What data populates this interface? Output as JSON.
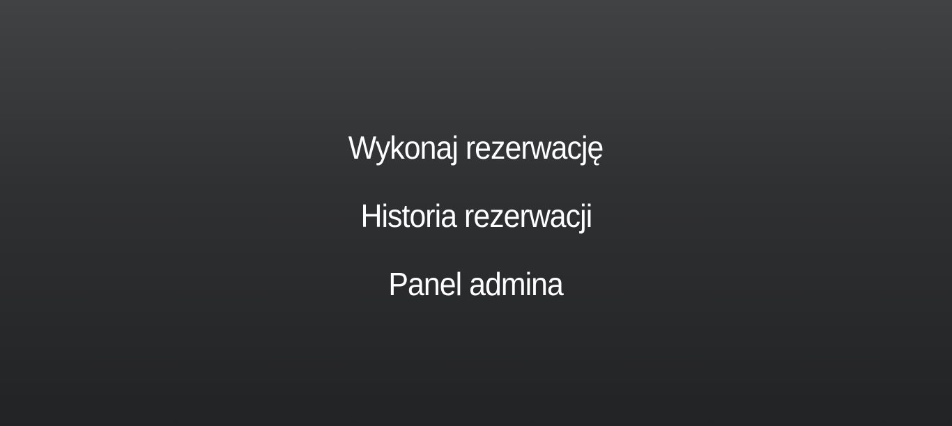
{
  "menu": {
    "items": [
      {
        "label": "Wykonaj rezerwację"
      },
      {
        "label": "Historia rezerwacji"
      },
      {
        "label": "Panel admina"
      }
    ]
  },
  "colors": {
    "text": "#ffffff",
    "background_top": "#414244",
    "background_bottom": "#222325"
  }
}
